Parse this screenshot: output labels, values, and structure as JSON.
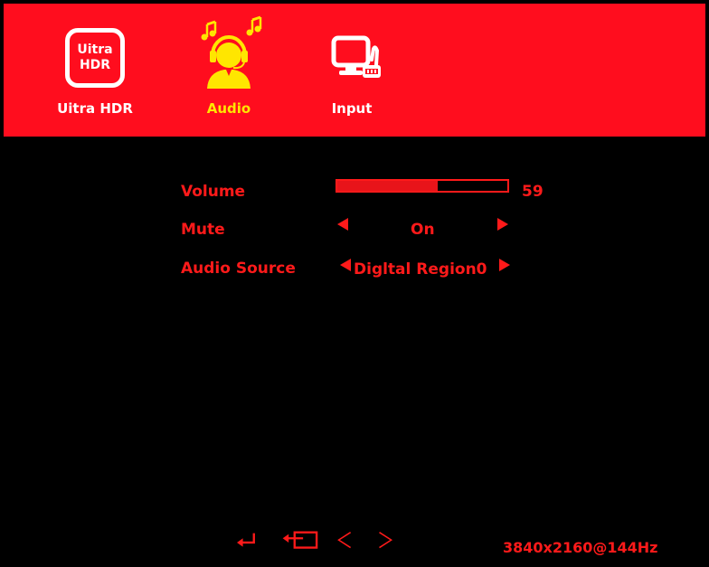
{
  "tabs": [
    {
      "label": "Uitra HDR",
      "icon": "ultra-hdr-icon",
      "box_line1": "Uitra",
      "box_line2": "HDR",
      "active": false
    },
    {
      "label": "Audio",
      "icon": "headset-person-icon",
      "active": true
    },
    {
      "label": "Input",
      "icon": "monitor-input-icon",
      "active": false
    }
  ],
  "settings": {
    "volume": {
      "label": "Volume",
      "value": "59",
      "level": 59
    },
    "mute": {
      "label": "Mute",
      "value": "On"
    },
    "audio_source": {
      "label": "Audio Source",
      "value": "Digltal Region0"
    }
  },
  "footer": {
    "icons": [
      "enter-icon",
      "exit-icon",
      "left-chevron-icon",
      "right-chevron-icon"
    ],
    "resolution": "3840x2160@144Hz"
  },
  "colors": {
    "accent_bar": "#ff0d1e",
    "text_red": "#ff1a1a",
    "active_yellow": "#ffe600",
    "background": "#000000"
  }
}
